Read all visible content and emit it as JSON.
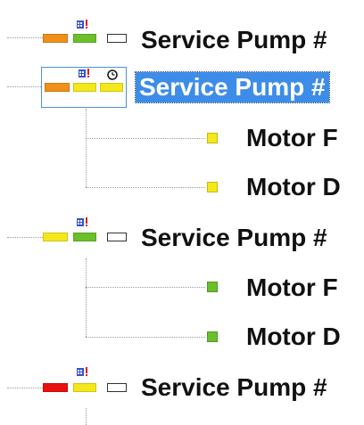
{
  "colors": {
    "orange": "#f0901a",
    "green": "#6abf2a",
    "yellow": "#f4e81a",
    "red": "#e81010",
    "selection": "#3d8de8",
    "badge_red": "#d62020",
    "badge_blue": "#3355cc"
  },
  "tree": {
    "nodes": [
      {
        "label": "Service Pump #",
        "selected": false,
        "status_bars": [
          "orange",
          "green"
        ],
        "has_empty_box": true,
        "icons": [
          "alert-calendar-icon"
        ]
      },
      {
        "label": "Service Pump #",
        "selected": true,
        "status_bars": [
          "orange",
          "yellow",
          "yellow"
        ],
        "has_empty_box": false,
        "icons": [
          "alert-calendar-icon",
          "clock-icon"
        ],
        "children": [
          {
            "label": "Motor F",
            "status": "yellow"
          },
          {
            "label": "Motor D",
            "status": "yellow"
          }
        ]
      },
      {
        "label": "Service Pump #",
        "selected": false,
        "status_bars": [
          "yellow",
          "green"
        ],
        "has_empty_box": true,
        "icons": [
          "alert-calendar-icon"
        ],
        "children": [
          {
            "label": "Motor F",
            "status": "green"
          },
          {
            "label": "Motor D",
            "status": "green"
          }
        ]
      },
      {
        "label": "Service Pump #",
        "selected": false,
        "status_bars": [
          "red",
          "yellow"
        ],
        "has_empty_box": true,
        "icons": [
          "alert-calendar-icon"
        ]
      }
    ]
  }
}
